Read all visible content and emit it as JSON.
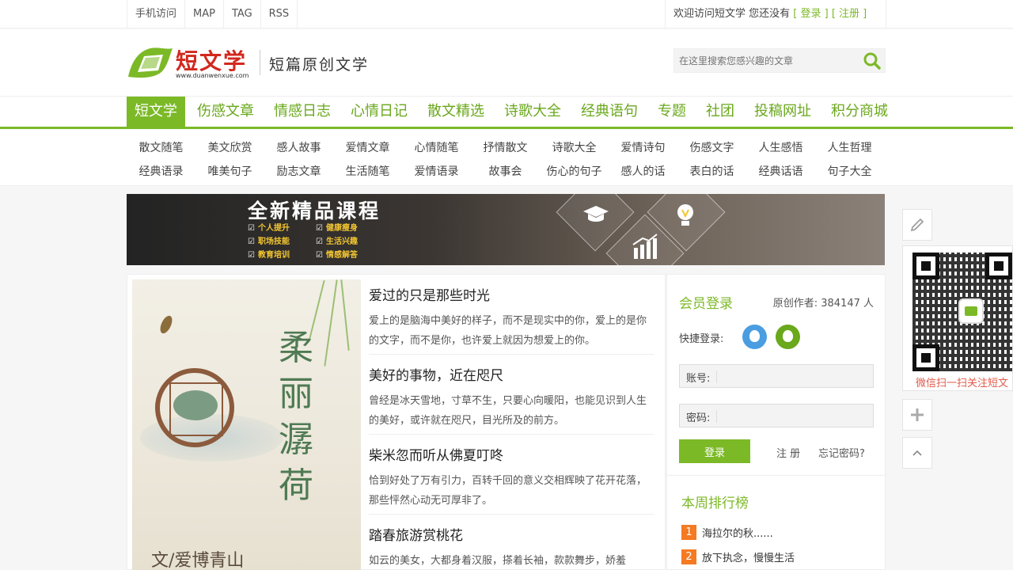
{
  "topbar": {
    "links": [
      "手机访问",
      "MAP",
      "TAG",
      "RSS"
    ],
    "welcome": "欢迎访问短文学 您还没有",
    "login": "[ 登录 ]",
    "register": "[ 注册 ]"
  },
  "header": {
    "logo_text": "短文学",
    "logo_url": "www.duanwenxue.com",
    "slogan": "短篇原创文学",
    "search_placeholder": "在这里搜索您感兴趣的文章"
  },
  "nav": {
    "items": [
      "短文学",
      "伤感文章",
      "情感日志",
      "心情日记",
      "散文精选",
      "诗歌大全",
      "经典语句",
      "专题",
      "社团",
      "投稿网址",
      "积分商城"
    ]
  },
  "subnav": {
    "row1": [
      "散文随笔",
      "美文欣赏",
      "感人故事",
      "爱情文章",
      "心情随笔",
      "抒情散文",
      "诗歌大全",
      "爱情诗句",
      "伤感文字",
      "人生感悟",
      "人生哲理"
    ],
    "row2": [
      "经典语录",
      "唯美句子",
      "励志文章",
      "生活随笔",
      "爱情语录",
      "故事会",
      "伤心的句子",
      "感人的话",
      "表白的话",
      "经典话语",
      "句子大全"
    ]
  },
  "banner": {
    "title": "全新精品课程",
    "items": [
      "个人提升",
      "健康瘦身",
      "职场技能",
      "生活兴趣",
      "教育培训",
      "情感解答"
    ]
  },
  "cover": {
    "title": "柔丽潺荷",
    "author": "文/爱博青山"
  },
  "articles": [
    {
      "title": "爱过的只是那些时光",
      "summary": "爱上的是脑海中美好的样子，而不是现实中的你，爱上的是你的文字，而不是你，也许爱上就因为想爱上的你。"
    },
    {
      "title": "美好的事物，近在咫尺",
      "summary": "曾经是冰天雪地，寸草不生，只要心向暖阳，也能见识到人生的美好，或许就在咫尺，目光所及的前方。"
    },
    {
      "title": "柴米忽而听从佛夏叮咚",
      "summary": "恰到好处了万有引力，百转千回的意义交相辉映了花开花落，那些怦然心动无可厚非了。"
    },
    {
      "title": "踏春旅游赏桃花",
      "summary": "如云的美女，大都身着汉服，搽着长袖，款款舞步，娇羞"
    }
  ],
  "sidebar": {
    "login_title": "会员登录",
    "author_count": "原创作者: 384147 人",
    "quick_login": "快捷登录:",
    "account_label": "账号:",
    "password_label": "密码:",
    "login_button": "登录",
    "register_link": "注 册",
    "forgot_link": "忘记密码?",
    "rank_title": "本周排行榜",
    "rank": [
      {
        "num": "1",
        "title": "海拉尔的秋......"
      },
      {
        "num": "2",
        "title": "放下执念，慢慢生活"
      }
    ]
  },
  "float_tools": {
    "qr_caption": "微信扫一扫关注短文"
  },
  "colors": {
    "brand_green": "#7cb927",
    "logo_red": "#d2281e",
    "rank_orange": "#f57a22",
    "qq_blue": "#4a9de0"
  }
}
